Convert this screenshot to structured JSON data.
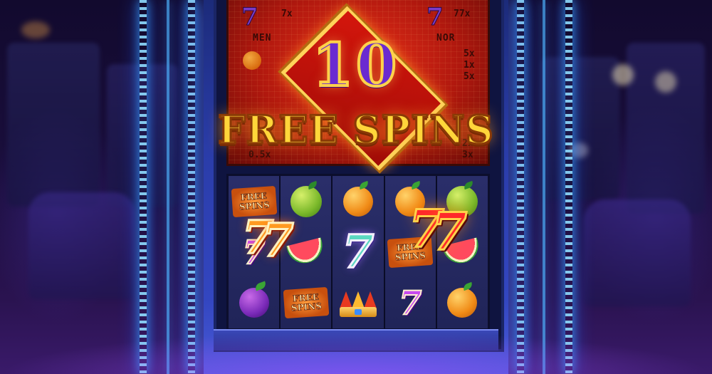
{
  "promo": {
    "count": "10",
    "headline": "FREE SPINS"
  },
  "paytable": {
    "left_mult": "7x",
    "left_label": "MEN",
    "right_mult": "77x",
    "right_label": "NOR",
    "side_mults": [
      "5x",
      "1x",
      "5x"
    ],
    "low_left": "0.5x",
    "low_right_1": "2x",
    "low_right_2": "3x",
    "seven_glyph": "7"
  },
  "reels": [
    [
      "free-spins",
      "seven",
      "plum"
    ],
    [
      "lime",
      "watermelon",
      "free-spins"
    ],
    [
      "orange",
      "seven-holo",
      "crown"
    ],
    [
      "orange",
      "free-spins",
      "seven"
    ],
    [
      "lime",
      "seven-fire",
      "orange"
    ]
  ],
  "symbols": {
    "free_spins_text": "FREE SPINS",
    "seven": "7"
  },
  "colors": {
    "neon": "#4fb4ff",
    "panel_red": "#d4160c",
    "gold": "#ffd63a",
    "purple": "#6a2ad0"
  }
}
